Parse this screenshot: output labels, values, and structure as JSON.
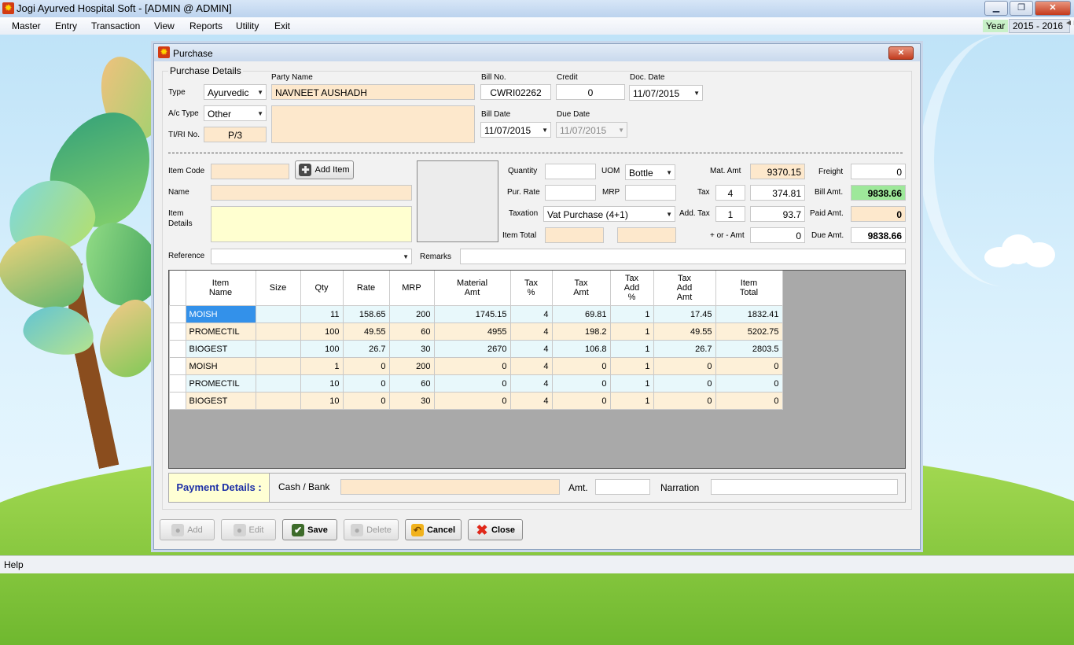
{
  "app": {
    "title": "Jogi Ayurved Hospital Soft - [ADMIN @ ADMIN]",
    "min": "▁",
    "max": "❐",
    "close": "✕"
  },
  "menu": {
    "items": [
      "Master",
      "Entry",
      "Transaction",
      "View",
      "Reports",
      "Utility",
      "Exit"
    ],
    "year_label": "Year",
    "year_value": "2015 - 2016"
  },
  "window": {
    "title": "Purchase",
    "close": "✕"
  },
  "details": {
    "group_title": "Purchase Details",
    "type_label": "Type",
    "type_value": "Ayurvedic",
    "actype_label": "A/c Type",
    "actype_value": "Other",
    "tiri_label": "TI/RI No.",
    "tiri_value": "P/3",
    "party_label": "Party Name",
    "party_value": "NAVNEET AUSHADH",
    "billno_label": "Bill No.",
    "billno_value": "CWRI02262",
    "credit_label": "Credit",
    "credit_value": "0",
    "docdate_label": "Doc. Date",
    "docdate_value": "11/07/2015",
    "billdate_label": "Bill Date",
    "billdate_value": "11/07/2015",
    "duedate_label": "Due Date",
    "duedate_value": "11/07/2015"
  },
  "item": {
    "code_label": "Item Code",
    "code_value": "",
    "add_item": "Add Item",
    "name_label": "Name",
    "name_value": "",
    "details_label1": "Item",
    "details_label2": "Details",
    "qty_label": "Quantity",
    "qty_value": "",
    "uom_label": "UOM",
    "uom_value": "Bottle",
    "purrate_label": "Pur. Rate",
    "purrate_value": "",
    "mrp_label": "MRP",
    "mrp_value": "",
    "taxation_label": "Taxation",
    "taxation_value": "Vat Purchase (4+1)",
    "itemtotal_label": "Item Total",
    "itemtotal_value": "",
    "reference_label": "Reference",
    "reference_value": "",
    "remarks_label": "Remarks",
    "remarks_value": ""
  },
  "totals": {
    "matamt_label": "Mat. Amt",
    "matamt_value": "9370.15",
    "tax_label": "Tax",
    "tax_pct": "4",
    "tax_value": "374.81",
    "addtax_label": "Add. Tax",
    "addtax_pct": "1",
    "addtax_value": "93.7",
    "plusminus_label": "+ or - Amt",
    "plusminus_value": "0",
    "freight_label": "Freight",
    "freight_value": "0",
    "billamt_label": "Bill Amt.",
    "billamt_value": "9838.66",
    "paidamt_label": "Paid Amt.",
    "paidamt_value": "0",
    "dueamt_label": "Due Amt.",
    "dueamt_value": "9838.66"
  },
  "grid": {
    "headers": [
      [
        "Item",
        "Name"
      ],
      [
        "Size"
      ],
      [
        "Qty"
      ],
      [
        "Rate"
      ],
      [
        "MRP"
      ],
      [
        "Material",
        "Amt"
      ],
      [
        "Tax",
        "%"
      ],
      [
        "Tax",
        "Amt"
      ],
      [
        "Tax",
        "Add",
        "%"
      ],
      [
        "Tax",
        "Add",
        "Amt"
      ],
      [
        "Item",
        "Total"
      ]
    ],
    "rows": [
      [
        "MOISH",
        "",
        "11",
        "158.65",
        "200",
        "1745.15",
        "4",
        "69.81",
        "1",
        "17.45",
        "1832.41"
      ],
      [
        "PROMECTIL",
        "",
        "100",
        "49.55",
        "60",
        "4955",
        "4",
        "198.2",
        "1",
        "49.55",
        "5202.75"
      ],
      [
        "BIOGEST",
        "",
        "100",
        "26.7",
        "30",
        "2670",
        "4",
        "106.8",
        "1",
        "26.7",
        "2803.5"
      ],
      [
        "MOISH",
        "",
        "1",
        "0",
        "200",
        "0",
        "4",
        "0",
        "1",
        "0",
        "0"
      ],
      [
        "PROMECTIL",
        "",
        "10",
        "0",
        "60",
        "0",
        "4",
        "0",
        "1",
        "0",
        "0"
      ],
      [
        "BIOGEST",
        "",
        "10",
        "0",
        "30",
        "0",
        "4",
        "0",
        "1",
        "0",
        "0"
      ]
    ]
  },
  "payment": {
    "title": "Payment Details :",
    "cash_label": "Cash / Bank",
    "cash_value": "",
    "amt_label": "Amt.",
    "amt_value": "",
    "narration_label": "Narration",
    "narration_value": ""
  },
  "buttons": {
    "add": "Add",
    "edit": "Edit",
    "save": "Save",
    "delete": "Delete",
    "cancel": "Cancel",
    "close": "Close"
  },
  "status": {
    "help": "Help"
  }
}
